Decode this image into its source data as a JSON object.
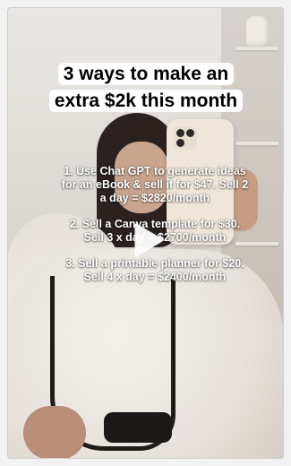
{
  "post": {
    "headline_line1": "3 ways to make an",
    "headline_line2": "extra $2k this month",
    "tips": [
      {
        "line1": "1. Use Chat GPT to generate ideas",
        "line2": "for an eBook & sell it for $47. Sell 2",
        "line3": "a day = $2820/month"
      },
      {
        "line1": "2. Sell a Canva template for $30.",
        "line2": "Sell 3 x day = $2700/month"
      },
      {
        "line1": "3. Sell a printable planner for $20.",
        "line2": "Sell 4 x day = $2400/month"
      }
    ]
  },
  "player": {
    "play_icon": "play-icon",
    "icon_color": "#ffffff"
  }
}
